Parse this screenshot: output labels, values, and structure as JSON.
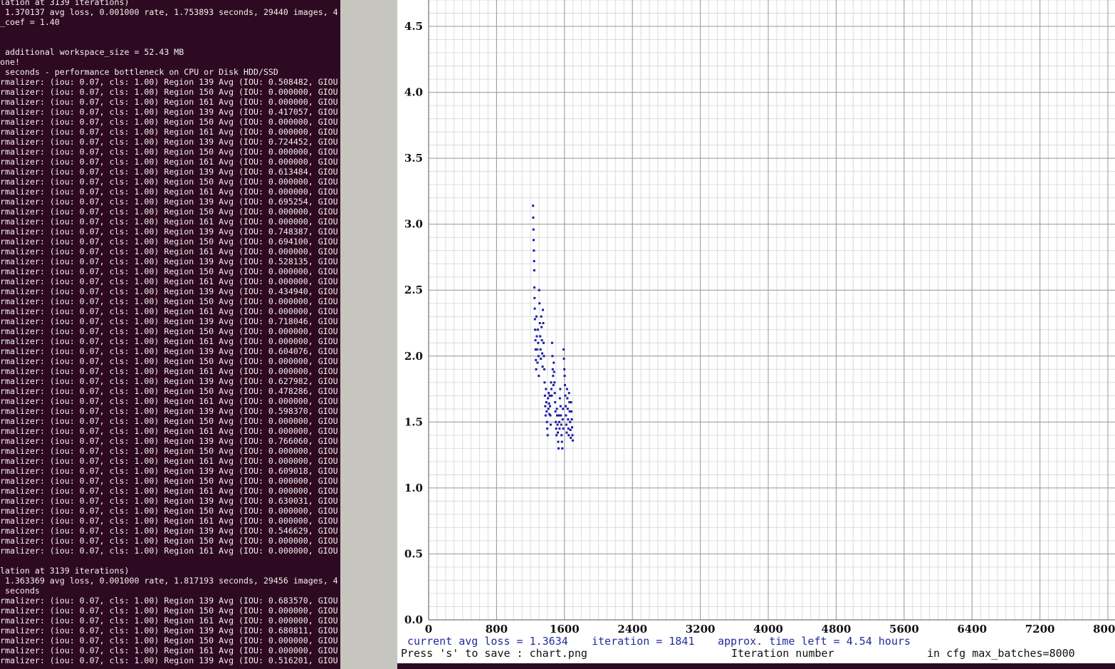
{
  "terminal": {
    "lines": [
      "lation at 3139 iterations)",
      " 1.370137 avg loss, 0.001000 rate, 1.753893 seconds, 29440 images, 4",
      "_coef = 1.40",
      "",
      "",
      " additional workspace_size = 52.43 MB",
      "one!",
      " seconds - performance bottleneck on CPU or Disk HDD/SSD",
      "rmalizer: (iou: 0.07, cls: 1.00) Region 139 Avg (IOU: 0.508482, GIOU",
      "rmalizer: (iou: 0.07, cls: 1.00) Region 150 Avg (IOU: 0.000000, GIOU",
      "rmalizer: (iou: 0.07, cls: 1.00) Region 161 Avg (IOU: 0.000000, GIOU",
      "rmalizer: (iou: 0.07, cls: 1.00) Region 139 Avg (IOU: 0.417057, GIOU",
      "rmalizer: (iou: 0.07, cls: 1.00) Region 150 Avg (IOU: 0.000000, GIOU",
      "rmalizer: (iou: 0.07, cls: 1.00) Region 161 Avg (IOU: 0.000000, GIOU",
      "rmalizer: (iou: 0.07, cls: 1.00) Region 139 Avg (IOU: 0.724452, GIOU",
      "rmalizer: (iou: 0.07, cls: 1.00) Region 150 Avg (IOU: 0.000000, GIOU",
      "rmalizer: (iou: 0.07, cls: 1.00) Region 161 Avg (IOU: 0.000000, GIOU",
      "rmalizer: (iou: 0.07, cls: 1.00) Region 139 Avg (IOU: 0.613484, GIOU",
      "rmalizer: (iou: 0.07, cls: 1.00) Region 150 Avg (IOU: 0.000000, GIOU",
      "rmalizer: (iou: 0.07, cls: 1.00) Region 161 Avg (IOU: 0.000000, GIOU",
      "rmalizer: (iou: 0.07, cls: 1.00) Region 139 Avg (IOU: 0.695254, GIOU",
      "rmalizer: (iou: 0.07, cls: 1.00) Region 150 Avg (IOU: 0.000000, GIOU",
      "rmalizer: (iou: 0.07, cls: 1.00) Region 161 Avg (IOU: 0.000000, GIOU",
      "rmalizer: (iou: 0.07, cls: 1.00) Region 139 Avg (IOU: 0.748387, GIOU",
      "rmalizer: (iou: 0.07, cls: 1.00) Region 150 Avg (IOU: 0.694100, GIOU",
      "rmalizer: (iou: 0.07, cls: 1.00) Region 161 Avg (IOU: 0.000000, GIOU",
      "rmalizer: (iou: 0.07, cls: 1.00) Region 139 Avg (IOU: 0.528135, GIOU",
      "rmalizer: (iou: 0.07, cls: 1.00) Region 150 Avg (IOU: 0.000000, GIOU",
      "rmalizer: (iou: 0.07, cls: 1.00) Region 161 Avg (IOU: 0.000000, GIOU",
      "rmalizer: (iou: 0.07, cls: 1.00) Region 139 Avg (IOU: 0.434940, GIOU",
      "rmalizer: (iou: 0.07, cls: 1.00) Region 150 Avg (IOU: 0.000000, GIOU",
      "rmalizer: (iou: 0.07, cls: 1.00) Region 161 Avg (IOU: 0.000000, GIOU",
      "rmalizer: (iou: 0.07, cls: 1.00) Region 139 Avg (IOU: 0.718046, GIOU",
      "rmalizer: (iou: 0.07, cls: 1.00) Region 150 Avg (IOU: 0.000000, GIOU",
      "rmalizer: (iou: 0.07, cls: 1.00) Region 161 Avg (IOU: 0.000000, GIOU",
      "rmalizer: (iou: 0.07, cls: 1.00) Region 139 Avg (IOU: 0.604076, GIOU",
      "rmalizer: (iou: 0.07, cls: 1.00) Region 150 Avg (IOU: 0.000000, GIOU",
      "rmalizer: (iou: 0.07, cls: 1.00) Region 161 Avg (IOU: 0.000000, GIOU",
      "rmalizer: (iou: 0.07, cls: 1.00) Region 139 Avg (IOU: 0.627982, GIOU",
      "rmalizer: (iou: 0.07, cls: 1.00) Region 150 Avg (IOU: 0.478286, GIOU",
      "rmalizer: (iou: 0.07, cls: 1.00) Region 161 Avg (IOU: 0.000000, GIOU",
      "rmalizer: (iou: 0.07, cls: 1.00) Region 139 Avg (IOU: 0.598370, GIOU",
      "rmalizer: (iou: 0.07, cls: 1.00) Region 150 Avg (IOU: 0.000000, GIOU",
      "rmalizer: (iou: 0.07, cls: 1.00) Region 161 Avg (IOU: 0.000000, GIOU",
      "rmalizer: (iou: 0.07, cls: 1.00) Region 139 Avg (IOU: 0.766060, GIOU",
      "rmalizer: (iou: 0.07, cls: 1.00) Region 150 Avg (IOU: 0.000000, GIOU",
      "rmalizer: (iou: 0.07, cls: 1.00) Region 161 Avg (IOU: 0.000000, GIOU",
      "rmalizer: (iou: 0.07, cls: 1.00) Region 139 Avg (IOU: 0.609018, GIOU",
      "rmalizer: (iou: 0.07, cls: 1.00) Region 150 Avg (IOU: 0.000000, GIOU",
      "rmalizer: (iou: 0.07, cls: 1.00) Region 161 Avg (IOU: 0.000000, GIOU",
      "rmalizer: (iou: 0.07, cls: 1.00) Region 139 Avg (IOU: 0.630031, GIOU",
      "rmalizer: (iou: 0.07, cls: 1.00) Region 150 Avg (IOU: 0.000000, GIOU",
      "rmalizer: (iou: 0.07, cls: 1.00) Region 161 Avg (IOU: 0.000000, GIOU",
      "rmalizer: (iou: 0.07, cls: 1.00) Region 139 Avg (IOU: 0.546629, GIOU",
      "rmalizer: (iou: 0.07, cls: 1.00) Region 150 Avg (IOU: 0.000000, GIOU",
      "rmalizer: (iou: 0.07, cls: 1.00) Region 161 Avg (IOU: 0.000000, GIOU",
      "",
      "lation at 3139 iterations)",
      " 1.363369 avg loss, 0.001000 rate, 1.817193 seconds, 29456 images, 4",
      " seconds",
      "rmalizer: (iou: 0.07, cls: 1.00) Region 139 Avg (IOU: 0.683570, GIOU",
      "rmalizer: (iou: 0.07, cls: 1.00) Region 150 Avg (IOU: 0.000000, GIOU",
      "rmalizer: (iou: 0.07, cls: 1.00) Region 161 Avg (IOU: 0.000000, GIOU",
      "rmalizer: (iou: 0.07, cls: 1.00) Region 139 Avg (IOU: 0.680811, GIOU",
      "rmalizer: (iou: 0.07, cls: 1.00) Region 150 Avg (IOU: 0.000000, GIOU",
      "rmalizer: (iou: 0.07, cls: 1.00) Region 161 Avg (IOU: 0.000000, GIOU",
      "rmalizer: (iou: 0.07, cls: 1.00) Region 139 Avg (IOU: 0.516201, GIOU"
    ]
  },
  "status": {
    "current_avg_loss": "current avg loss = 1.3634",
    "iteration": "iteration = 1841",
    "time_left": "approx. time left = 4.54 hours",
    "save_hint": "Press 's' to save : chart.png",
    "x_axis_title": "Iteration number",
    "max_batches": "in cfg max_batches=8000"
  },
  "colors": {
    "terminal_bg": "#2d0a22",
    "terminal_fg": "#f2efea",
    "point": "#1a1aa8",
    "status_blue": "#1f2d9c"
  },
  "chart_data": {
    "type": "scatter",
    "title": "",
    "xlabel": "Iteration number",
    "ylabel": "",
    "xlim": [
      0,
      8000
    ],
    "ylim": [
      0,
      4.7
    ],
    "grid": true,
    "x_ticks": [
      "0",
      "800",
      "1600",
      "2400",
      "3200",
      "4000",
      "4800",
      "5600",
      "6400",
      "7200",
      "8000"
    ],
    "y_ticks": [
      "0.0",
      "0.5",
      "1.0",
      "1.5",
      "2.0",
      "2.5",
      "3.0",
      "3.5",
      "4.0",
      "4.5"
    ],
    "series": [
      {
        "name": "",
        "points": [
          [
            1230,
            3.14
          ],
          [
            1232,
            3.05
          ],
          [
            1235,
            2.96
          ],
          [
            1237,
            2.88
          ],
          [
            1240,
            2.8
          ],
          [
            1242,
            2.72
          ],
          [
            1244,
            2.65
          ],
          [
            1246,
            2.52
          ],
          [
            1248,
            2.44
          ],
          [
            1250,
            2.36
          ],
          [
            1252,
            2.28
          ],
          [
            1255,
            2.2
          ],
          [
            1258,
            2.12
          ],
          [
            1260,
            2.05
          ],
          [
            1263,
            1.97
          ],
          [
            1266,
            1.9
          ],
          [
            1270,
            2.3
          ],
          [
            1274,
            2.15
          ],
          [
            1278,
            2.05
          ],
          [
            1282,
            1.95
          ],
          [
            1286,
            2.2
          ],
          [
            1290,
            2.1
          ],
          [
            1294,
            2.0
          ],
          [
            1298,
            1.85
          ],
          [
            1302,
            2.5
          ],
          [
            1306,
            2.4
          ],
          [
            1310,
            2.25
          ],
          [
            1314,
            2.15
          ],
          [
            1318,
            2.05
          ],
          [
            1322,
            1.98
          ],
          [
            1326,
            2.3
          ],
          [
            1330,
            2.22
          ],
          [
            1334,
            2.12
          ],
          [
            1338,
            2.02
          ],
          [
            1342,
            1.92
          ],
          [
            1346,
            2.35
          ],
          [
            1350,
            2.25
          ],
          [
            1354,
            2.1
          ],
          [
            1358,
            2.0
          ],
          [
            1362,
            1.9
          ],
          [
            1366,
            1.8
          ],
          [
            1370,
            1.7
          ],
          [
            1374,
            1.62
          ],
          [
            1378,
            1.55
          ],
          [
            1382,
            1.75
          ],
          [
            1386,
            1.65
          ],
          [
            1390,
            1.58
          ],
          [
            1394,
            1.5
          ],
          [
            1398,
            1.45
          ],
          [
            1402,
            1.4
          ],
          [
            1406,
            1.68
          ],
          [
            1410,
            1.6
          ],
          [
            1414,
            1.72
          ],
          [
            1418,
            1.64
          ],
          [
            1422,
            1.56
          ],
          [
            1426,
            1.7
          ],
          [
            1430,
            1.62
          ],
          [
            1434,
            1.55
          ],
          [
            1438,
            1.48
          ],
          [
            1442,
            1.8
          ],
          [
            1446,
            1.75
          ],
          [
            1450,
            1.7
          ],
          [
            1454,
            2.1
          ],
          [
            1458,
            2.0
          ],
          [
            1462,
            1.9
          ],
          [
            1466,
            1.85
          ],
          [
            1470,
            1.78
          ],
          [
            1474,
            1.95
          ],
          [
            1478,
            1.88
          ],
          [
            1482,
            1.8
          ],
          [
            1486,
            1.72
          ],
          [
            1490,
            1.65
          ],
          [
            1494,
            1.58
          ],
          [
            1498,
            1.5
          ],
          [
            1502,
            1.45
          ],
          [
            1506,
            1.4
          ],
          [
            1510,
            1.6
          ],
          [
            1514,
            1.55
          ],
          [
            1518,
            1.48
          ],
          [
            1522,
            1.42
          ],
          [
            1526,
            1.35
          ],
          [
            1530,
            1.3
          ],
          [
            1534,
            1.55
          ],
          [
            1538,
            1.5
          ],
          [
            1542,
            1.45
          ],
          [
            1546,
            1.68
          ],
          [
            1550,
            1.75
          ],
          [
            1554,
            1.62
          ],
          [
            1558,
            1.55
          ],
          [
            1562,
            1.48
          ],
          [
            1566,
            1.4
          ],
          [
            1570,
            1.35
          ],
          [
            1574,
            1.3
          ],
          [
            1578,
            1.52
          ],
          [
            1582,
            1.6
          ],
          [
            1586,
            1.45
          ],
          [
            1590,
            2.05
          ],
          [
            1594,
            1.98
          ],
          [
            1598,
            1.9
          ],
          [
            1602,
            1.85
          ],
          [
            1606,
            1.78
          ],
          [
            1610,
            1.7
          ],
          [
            1614,
            1.62
          ],
          [
            1618,
            1.55
          ],
          [
            1622,
            1.48
          ],
          [
            1626,
            1.42
          ],
          [
            1630,
            1.75
          ],
          [
            1634,
            1.68
          ],
          [
            1638,
            1.6
          ],
          [
            1642,
            1.52
          ],
          [
            1646,
            1.45
          ],
          [
            1650,
            1.4
          ],
          [
            1654,
            1.72
          ],
          [
            1658,
            1.65
          ],
          [
            1662,
            1.58
          ],
          [
            1666,
            1.5
          ],
          [
            1670,
            1.44
          ],
          [
            1674,
            1.38
          ],
          [
            1678,
            1.65
          ],
          [
            1682,
            1.58
          ],
          [
            1686,
            1.52
          ],
          [
            1690,
            1.46
          ],
          [
            1694,
            1.4
          ],
          [
            1698,
            1.36
          ]
        ]
      }
    ]
  }
}
